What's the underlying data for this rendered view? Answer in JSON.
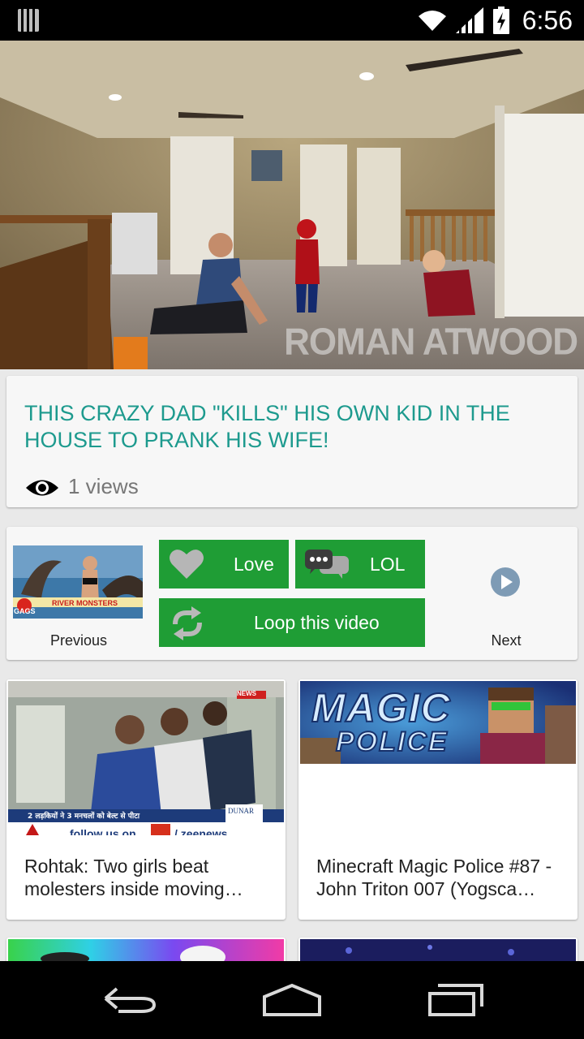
{
  "status_bar": {
    "time": "6:56"
  },
  "video": {
    "watermark": "ROMAN ATWOOD"
  },
  "title_card": {
    "title": "THIS CRAZY DAD \"KILLS\" HIS OWN KID IN THE HOUSE TO PRANK HIS WIFE!",
    "views": "1 views"
  },
  "actions": {
    "previous_label": "Previous",
    "next_label": "Next",
    "love_label": "Love",
    "lol_label": "LOL",
    "loop_label": "Loop this video",
    "prev_thumb_caption": "RIVER MONSTERS",
    "prev_thumb_logo": "GAGS"
  },
  "related": [
    {
      "title": "Rohtak: Two girls beat molesters inside moving…",
      "thumb_text": "2 लड़कियों ने 3 मनचलों को बेल्ट से पीटा",
      "thumb_badge": "DUNAR",
      "thumb_footer": "follow us on",
      "thumb_footer2": "/ zeenews",
      "thumb_news": "NEWS"
    },
    {
      "title": "Minecraft Magic Police #87 - John Triton 007 (Yogsca…",
      "thumb_line1": "MAGIC",
      "thumb_line2": "POLICE"
    },
    {
      "title": ""
    },
    {
      "title": ""
    }
  ],
  "colors": {
    "accent": "#1d9a8e",
    "green": "#1f9d35",
    "bg": "#e9e9e9"
  }
}
